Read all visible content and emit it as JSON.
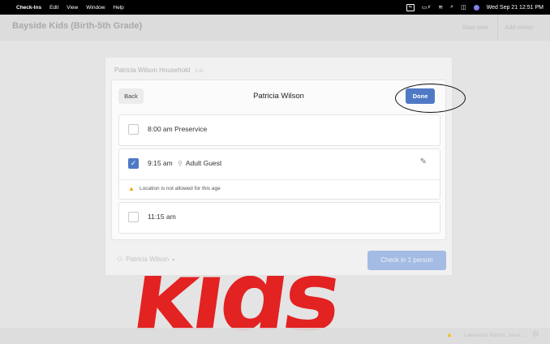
{
  "menubar": {
    "app_name": "Check-Ins",
    "menus": [
      "Edit",
      "View",
      "Window",
      "Help"
    ],
    "datetime": "Wed Sep 21  12:51 PM"
  },
  "header": {
    "title": "Bayside Kids (Birth-5th Grade)",
    "start_over": "Start over",
    "add_visitor": "Add visitor"
  },
  "modal": {
    "household": "Patricia Wilson Household",
    "edit": "Edit",
    "back_label": "Back",
    "person_name": "Patricia Wilson",
    "done_label": "Done",
    "events": [
      {
        "time_label": "8:00 am Preservice",
        "checked": false
      },
      {
        "time": "9:15 am",
        "location": "Adult Guest",
        "checked": true,
        "warning": "Location is not allowed for this age"
      },
      {
        "time_label": "11:15 am",
        "checked": false
      }
    ],
    "footer_person": "Patricia Wilson",
    "checkin_label": "Check in 1 person"
  },
  "background": {
    "logo_text": "kids"
  },
  "statusbar": {
    "location": "Lakewood Ranch: Janet ..."
  },
  "colors": {
    "accent": "#4f79c4",
    "logo_red": "#e32222",
    "warning": "#f2a900"
  }
}
